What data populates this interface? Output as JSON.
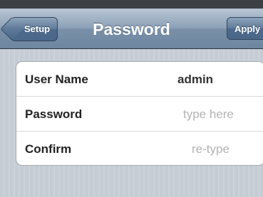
{
  "navbar": {
    "title": "Password",
    "back_label": "Setup",
    "apply_label": "Apply"
  },
  "form": {
    "username": {
      "label": "User Name",
      "value": "admin"
    },
    "password": {
      "label": "Password",
      "placeholder": "type here"
    },
    "confirm": {
      "label": "Confirm",
      "placeholder": "re-type"
    }
  }
}
